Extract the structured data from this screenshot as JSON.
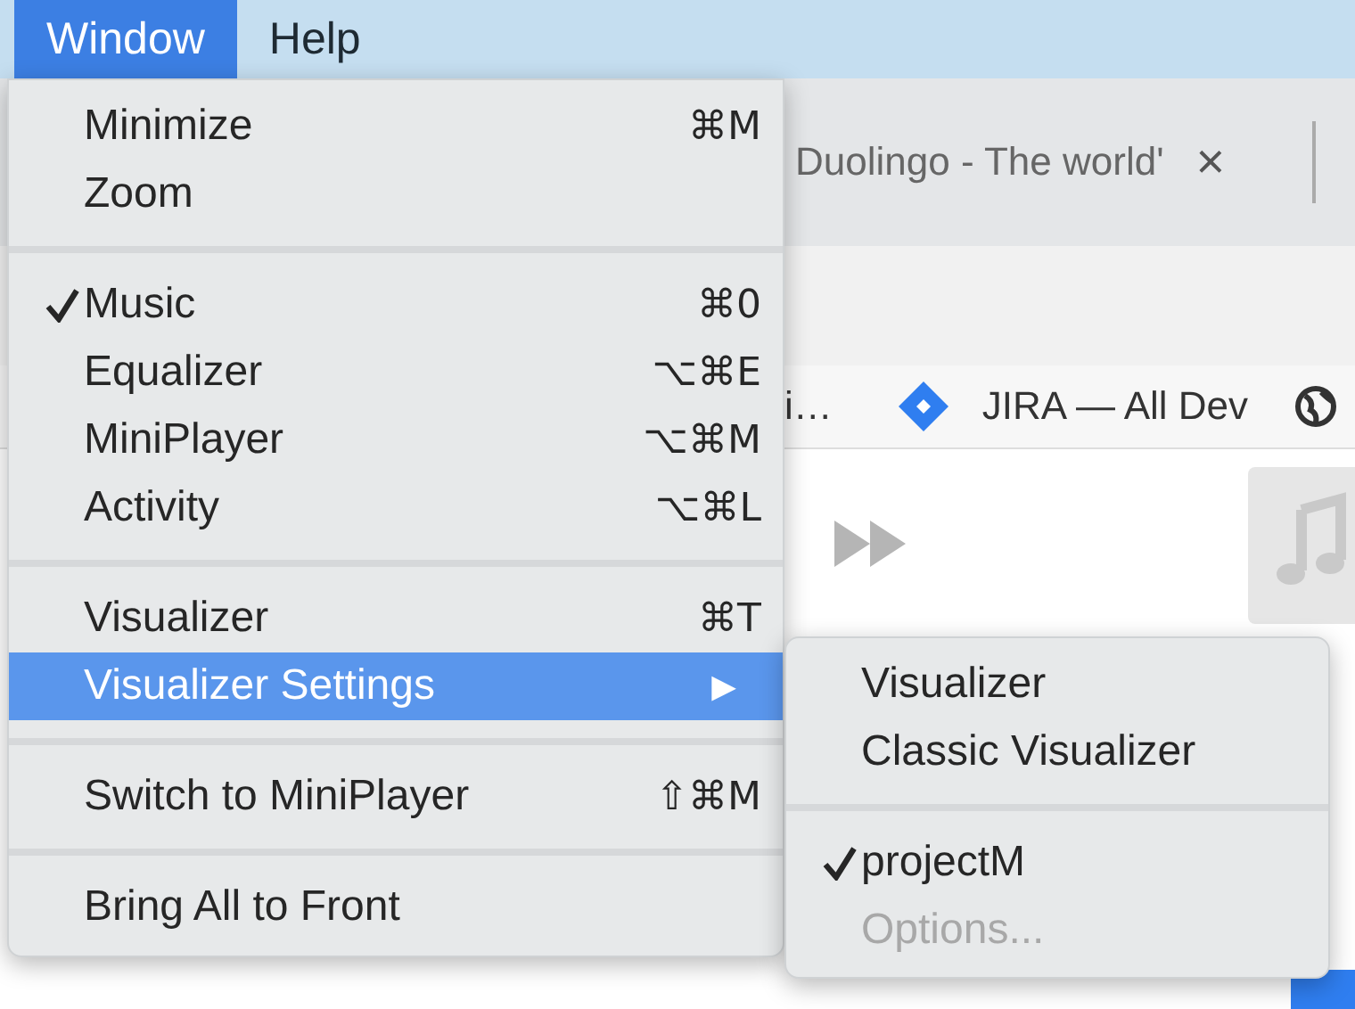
{
  "menubar": [
    {
      "label": "Window",
      "selected": true
    },
    {
      "label": "Help",
      "selected": false
    }
  ],
  "browser": {
    "tab": {
      "title": "Duolingo - The world'",
      "close": "×"
    },
    "bookmarks": [
      {
        "label": "i…"
      },
      {
        "label": "JIRA — All Dev"
      }
    ]
  },
  "menu": {
    "sections": [
      [
        {
          "label": "Minimize",
          "shortcut": "⌘M",
          "checked": false,
          "disabled": false,
          "highlighted": false
        },
        {
          "label": "Zoom",
          "checked": false,
          "disabled": false,
          "highlighted": false
        }
      ],
      [
        {
          "label": "Music",
          "shortcut": "⌘0",
          "checked": true,
          "disabled": false,
          "highlighted": false
        },
        {
          "label": "Equalizer",
          "shortcut": "⌥⌘E",
          "checked": false,
          "disabled": false,
          "highlighted": false
        },
        {
          "label": "MiniPlayer",
          "shortcut": "⌥⌘M",
          "checked": false,
          "disabled": false,
          "highlighted": false
        },
        {
          "label": "Activity",
          "shortcut": "⌥⌘L",
          "checked": false,
          "disabled": false,
          "highlighted": false
        }
      ],
      [
        {
          "label": "Visualizer",
          "shortcut": "⌘T",
          "checked": false,
          "disabled": false,
          "highlighted": false
        },
        {
          "label": "Visualizer Settings",
          "shortcut": "▶",
          "checked": false,
          "disabled": false,
          "highlighted": true,
          "submenu": true
        }
      ],
      [
        {
          "label": "Switch to MiniPlayer",
          "shortcut": "⇧⌘M",
          "checked": false,
          "disabled": false,
          "highlighted": false
        }
      ],
      [
        {
          "label": "Bring All to Front",
          "checked": false,
          "disabled": false,
          "highlighted": false
        }
      ]
    ]
  },
  "submenu": {
    "sections": [
      [
        {
          "label": "Visualizer",
          "checked": false,
          "disabled": false
        },
        {
          "label": "Classic Visualizer",
          "checked": false,
          "disabled": false
        }
      ],
      [
        {
          "label": "projectM",
          "checked": true,
          "disabled": false
        },
        {
          "label": "Options...",
          "checked": false,
          "disabled": true
        }
      ]
    ]
  }
}
